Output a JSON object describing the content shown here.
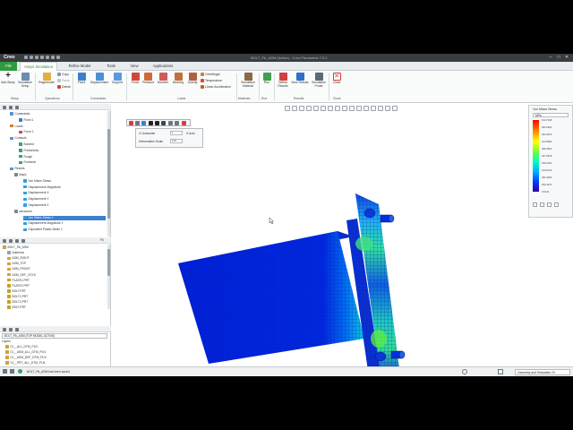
{
  "app": {
    "logo": "Creo",
    "title": "BOLT_PA_ASM (Active) - Creo Parametric 7.0.1"
  },
  "menu": {
    "tabs": [
      "File",
      "Ansys Simulation",
      "Refine Model",
      "Tools",
      "View",
      "Applications"
    ],
    "active": "Ansys Simulation"
  },
  "ribbon": {
    "setup": {
      "add_study": "Add Study",
      "simulation_setup": "Simulation Setup",
      "label": "Setup"
    },
    "operations": {
      "regenerate": "Regenerate",
      "copy": "Copy",
      "paste": "Paste",
      "delete": "Delete",
      "label": "Operations"
    },
    "constraints": {
      "fixed": "Fixed",
      "displacement": "Displacement",
      "support": "Support",
      "label": "Constraints"
    },
    "loads": {
      "force": "Force",
      "pressure": "Pressure",
      "moment": "Moment",
      "bearing": "Bearing",
      "gravity": "Gravity",
      "centrifugal": "Centrifugal",
      "temperature": "Temperature",
      "linear_acceleration": "Linear Acceleration",
      "label": "Loads"
    },
    "materials": {
      "simulation_material": "Simulation Material",
      "label": "Materials"
    },
    "run": {
      "run": "Run",
      "label": "Run"
    },
    "results": {
      "define_results": "Define Results",
      "view_results": "View Results",
      "simulation_probe": "Simulation Probe",
      "label": "Results"
    },
    "close": {
      "close": "Close",
      "label": "Close"
    }
  },
  "tree": {
    "items": [
      {
        "label": "Constraints",
        "indent": 1,
        "icon": "#5a8fd6"
      },
      {
        "label": "Fixed 1",
        "indent": 3,
        "icon": "#3a7fd0"
      },
      {
        "label": "Loads",
        "indent": 1,
        "icon": "#d07a3a"
      },
      {
        "label": "Force 1",
        "indent": 3,
        "icon": "#d04a3a"
      },
      {
        "label": "Contacts",
        "indent": 1,
        "icon": "#5a8fd6"
      },
      {
        "label": "Bonded",
        "indent": 3,
        "icon": "#3aa070"
      },
      {
        "label": "Frictionless",
        "indent": 3,
        "icon": "#3aa070"
      },
      {
        "label": "Rough",
        "indent": 3,
        "icon": "#3aa070"
      },
      {
        "label": "Frictional",
        "indent": 3,
        "icon": "#3aa070"
      },
      {
        "label": "Results",
        "indent": 1,
        "icon": "#5a8fd6"
      },
      {
        "label": "Basic",
        "indent": 2,
        "icon": "#7a8a96"
      },
      {
        "label": "Von Mises Stress",
        "indent": 4,
        "icon": "#30a0e0"
      },
      {
        "label": "Displacement Magnitude",
        "indent": 4,
        "icon": "#30a0e0"
      },
      {
        "label": "Displacement X",
        "indent": 4,
        "icon": "#30a0e0"
      },
      {
        "label": "Displacement Y",
        "indent": 4,
        "icon": "#30a0e0"
      },
      {
        "label": "Displacement Z",
        "indent": 4,
        "icon": "#30a0e0"
      },
      {
        "label": "advanced",
        "indent": 2,
        "icon": "#7a8a96"
      },
      {
        "label": "Von Mises Stress 1",
        "indent": 4,
        "icon": "#30a0e0",
        "selected": true
      },
      {
        "label": "Displacement Magnitude 1",
        "indent": 4,
        "icon": "#30a0e0"
      },
      {
        "label": "Equivalent Plastic Strain 1",
        "indent": 4,
        "icon": "#30a0e0"
      }
    ],
    "model_items": [
      {
        "label": "BOLT_PA_ASM",
        "indent": 0,
        "icon": "#d0a040"
      },
      {
        "label": "Addenda",
        "indent": 1,
        "icon": "#9aa3aa"
      },
      {
        "label": "ASM_RIGHT",
        "indent": 1,
        "icon": "#d0a040"
      },
      {
        "label": "ASM_TOP",
        "indent": 1,
        "icon": "#d0a040"
      },
      {
        "label": "ASM_FRONT",
        "indent": 1,
        "icon": "#d0a040"
      },
      {
        "label": "ASM_DEF_CSYS",
        "indent": 1,
        "icon": "#d0a040"
      },
      {
        "label": "PLATE1.PRT",
        "indent": 1,
        "icon": "#c8a020"
      },
      {
        "label": "PLATE2.PRT",
        "indent": 1,
        "icon": "#c8a020"
      },
      {
        "label": "BOLT.PRT",
        "indent": 1,
        "icon": "#c8a020"
      },
      {
        "label": "BOLT1.PRT",
        "indent": 1,
        "icon": "#c8a020"
      },
      {
        "label": "BOLT2.PRT",
        "indent": 1,
        "icon": "#c8a020"
      },
      {
        "label": "BOLT.PRT",
        "indent": 1,
        "icon": "#c8a020"
      }
    ],
    "search_label": "Fil",
    "layers_header": "BOLT_PA_ASM (TOP MODEL ACTIVE)",
    "layers_title": "Layers",
    "layers": [
      {
        "label": "01__ALL_DTM_PLN",
        "icon": "#d0a040"
      },
      {
        "label": "01__ASM_ALL_DTM_PLN",
        "icon": "#d0a040"
      },
      {
        "label": "01__ASM_DEF_DTM_PLN",
        "icon": "#d0a040"
      },
      {
        "label": "01__PRT_ALL_DTM_PLN",
        "icon": "#d0a040"
      }
    ]
  },
  "animation": {
    "autoscale_label": "Autoscale",
    "scale_value": "1",
    "auto_label": "X Auto",
    "deformation_scale_label": "Deformation Scale",
    "deformation_scale_value": "100"
  },
  "legend": {
    "title": "Von Mises Stress",
    "unit": "MPa",
    "ticks": [
      "510.7348",
      "482.0462",
      "453.4576",
      "424.8690",
      "396.2804",
      "367.6918",
      "339.1032",
      "310.5146",
      "281.9260",
      "253.3374",
      "0.5144"
    ]
  },
  "status": {
    "message": "BOLT_PA_ASM has been saved.",
    "filter": "Geometry and Simulation Ot"
  }
}
